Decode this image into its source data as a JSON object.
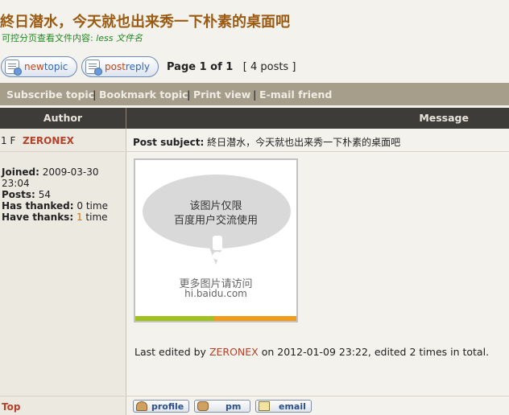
{
  "topic": {
    "title": "終日潜水，今天就也出来秀一下朴素的桌面吧",
    "subtitle_label": "可控分页查看文件内容:",
    "subtitle_link": "less 文件名"
  },
  "buttons": {
    "new_topic_a": "new",
    "new_topic_b": "topic",
    "post_reply_a": "post",
    "post_reply_b": "reply"
  },
  "pagination": {
    "page_text": "Page 1 of 1",
    "posts_text": "[ 4 posts ]"
  },
  "actions": {
    "subscribe": "Subscribe topic",
    "bookmark": "Bookmark topic",
    "print": "Print view",
    "email": "E-mail friend",
    "separator": "|"
  },
  "table_header": {
    "author": "Author",
    "message": "Message"
  },
  "post": {
    "floor": "1 F",
    "author": "ZERONEX",
    "joined_label": "Joined:",
    "joined_value_1": "2009-03-30",
    "joined_value_2": "23:04",
    "posts_label": "Posts:",
    "posts_value": "54",
    "thanked_label": "Has thanked:",
    "thanked_value": "0 time",
    "thanks_label": "Have thanks:",
    "thanks_count": "1",
    "thanks_unit": " time",
    "subject_label": "Post subject:",
    "subject_value": "終日潜水，今天就也出来秀一下朴素的桌面吧",
    "image_text_1": "该图片仅限",
    "image_text_2": "百度用户交流使用",
    "image_text_3": "更多图片请访问",
    "image_text_4": "hi.baidu.com",
    "edited_prefix": "Last edited by",
    "edited_by": "ZERONEX",
    "edited_suffix": "on 2012-01-09 23:22, edited 2 times in total."
  },
  "footer": {
    "top": "Top",
    "profile": "profile",
    "pm": "pm",
    "email": "email"
  }
}
